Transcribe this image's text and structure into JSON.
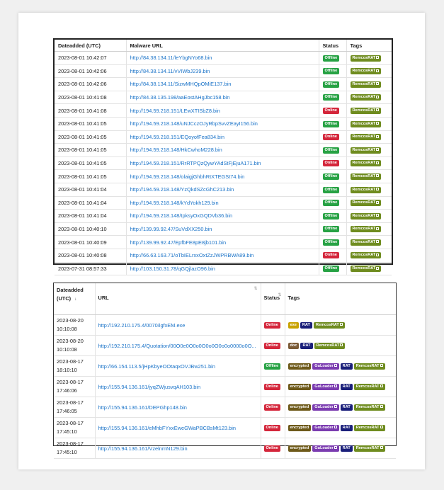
{
  "table1": {
    "headers": {
      "date": "Dateadded (UTC)",
      "url": "Malware URL",
      "status": "Status",
      "tags": "Tags"
    },
    "rows": [
      {
        "date": "2023-08-01 10:42:07",
        "url": "http://84.38.134.11/leYbgNYo68.bin",
        "status": "Offline",
        "tags": [
          "RemcosRAT"
        ]
      },
      {
        "date": "2023-08-01 10:42:06",
        "url": "http://84.38.134.11/vVIWbJ239.bin",
        "status": "Offline",
        "tags": [
          "RemcosRAT"
        ]
      },
      {
        "date": "2023-08-01 10:42:06",
        "url": "http://84.38.134.11/SizwMHQpOMiE137.bin",
        "status": "Offline",
        "tags": [
          "RemcosRAT"
        ]
      },
      {
        "date": "2023-08-01 10:41:08",
        "url": "http://84.38.135.198/aaEostAHgJbc158.bin",
        "status": "Offline",
        "tags": [
          "RemcosRAT"
        ]
      },
      {
        "date": "2023-08-01 10:41:08",
        "url": "http://194.59.218.151/LEwXTISbZ8.bin",
        "status": "Online",
        "tags": [
          "RemcosRAT"
        ]
      },
      {
        "date": "2023-08-01 10:41:05",
        "url": "http://194.59.218.148/uNJCczOJyRbpSvvZEayI156.bin",
        "status": "Offline",
        "tags": [
          "RemcosRAT"
        ]
      },
      {
        "date": "2023-08-01 10:41:05",
        "url": "http://194.59.218.151/EQoyofFea834.bin",
        "status": "Online",
        "tags": [
          "RemcosRAT"
        ]
      },
      {
        "date": "2023-08-01 10:41:05",
        "url": "http://194.59.218.148/HkCwhoM228.bin",
        "status": "Offline",
        "tags": [
          "RemcosRAT"
        ]
      },
      {
        "date": "2023-08-01 10:41:05",
        "url": "http://194.59.218.151/RrRTPQzQywYAdStFjEjuA171.bin",
        "status": "Online",
        "tags": [
          "RemcosRAT"
        ]
      },
      {
        "date": "2023-08-01 10:41:05",
        "url": "http://194.59.218.148/olaigjGhbhRtXTEGSt74.bin",
        "status": "Offline",
        "tags": [
          "RemcosRAT"
        ]
      },
      {
        "date": "2023-08-01 10:41:04",
        "url": "http://194.59.218.148/YzQkdSZcGhC213.bin",
        "status": "Offline",
        "tags": [
          "RemcosRAT"
        ]
      },
      {
        "date": "2023-08-01 10:41:04",
        "url": "http://194.59.218.148/kYdYokh129.bin",
        "status": "Offline",
        "tags": [
          "RemcosRAT"
        ]
      },
      {
        "date": "2023-08-01 10:41:04",
        "url": "http://194.59.218.148/tpksyOxGQDVb36.bin",
        "status": "Offline",
        "tags": [
          "RemcosRAT"
        ]
      },
      {
        "date": "2023-08-01 10:40:10",
        "url": "http://139.99.92.47/SuVdXX250.bin",
        "status": "Offline",
        "tags": [
          "RemcosRAT"
        ]
      },
      {
        "date": "2023-08-01 10:40:09",
        "url": "http://139.99.92.47/EpfbFE8pE8jb101.bin",
        "status": "Offline",
        "tags": [
          "RemcosRAT"
        ]
      },
      {
        "date": "2023-08-01 10:40:08",
        "url": "http://66.63.163.71/oTbIELrxxOxtZzJWPRBWA89.bin",
        "status": "Online",
        "tags": [
          "RemcosRAT"
        ]
      },
      {
        "date": "2023-07-31 08:57:33",
        "url": "http://103.150.31.78/qGQjlazO96.bin",
        "status": "Offline",
        "tags": [
          "RemcosRAT"
        ]
      }
    ]
  },
  "table2": {
    "headers": {
      "date": "Dateadded (UTC)",
      "url": "URL",
      "status": "Status",
      "tags": "Tags",
      "sort_active": "↓",
      "sort_inactive": "⇅"
    },
    "rows": [
      {
        "date": "2023-08-20 10:10:08",
        "url": "http://192.210.175.4/0070/igfxEM.exe",
        "status": "Online",
        "tags": [
          "exe",
          "RAT",
          "RemcosRAT"
        ]
      },
      {
        "date": "2023-08-20 10:10:08",
        "url": "http://192.210.175.4/Quotation/00O0e0O0o0O0o0O0o0o0000o0O...",
        "status": "Online",
        "tags": [
          "doc",
          "RAT",
          "RemcosRAT"
        ]
      },
      {
        "date": "2023-08-17 18:10:10",
        "url": "http://66.154.113.5/jHpKbyeOOtaqxOVJBw251.bin",
        "status": "Offline",
        "tags": [
          "encrypted",
          "GuLoader",
          "RAT",
          "RemcosRAT"
        ]
      },
      {
        "date": "2023-08-17 17:46:06",
        "url": "http://155.94.136.161/jyqZWjusvqAH103.bin",
        "status": "Online",
        "tags": [
          "encrypted",
          "GuLoader",
          "RAT",
          "RemcosRAT"
        ]
      },
      {
        "date": "2023-08-17 17:46:05",
        "url": "http://155.94.136.161/DEPGhp148.bin",
        "status": "Online",
        "tags": [
          "encrypted",
          "GuLoader",
          "RAT",
          "RemcosRAT"
        ]
      },
      {
        "date": "2023-08-17 17:45:10",
        "url": "http://155.94.136.161/eMhbFYxxEweGWaPBCBsMt123.bin",
        "status": "Online",
        "tags": [
          "encrypted",
          "GuLoader",
          "RAT",
          "RemcosRAT"
        ]
      },
      {
        "date": "2023-08-17 17:45:10",
        "url": "http://155.94.136.161/VzelnmN129.bin",
        "status": "Online",
        "tags": [
          "encrypted",
          "GuLoader",
          "RAT",
          "RemcosRAT"
        ]
      }
    ]
  },
  "colors": {
    "online": "#d4263b",
    "offline": "#27a244",
    "link": "#1a73c8",
    "remcos": "#6f8c1f",
    "rat": "#1a1f7a",
    "guloader": "#7b3cb0"
  }
}
